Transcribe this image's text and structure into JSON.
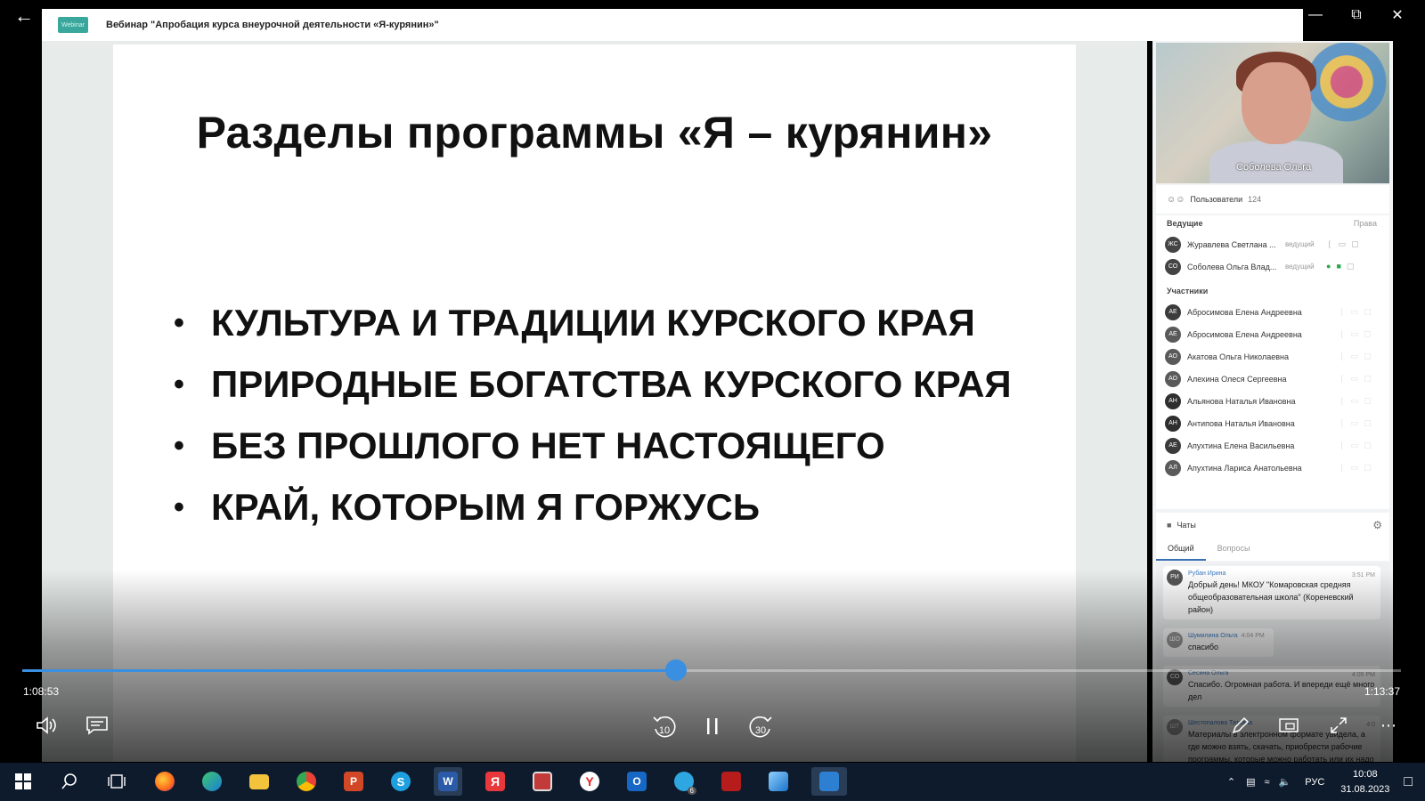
{
  "window": {
    "title": "Вебинар \"Апробация курса внеурочной деятельности «Я-курянин»\"",
    "logo_text": "Webinar"
  },
  "slide": {
    "title": "Разделы программы «Я – курянин»",
    "bullets": [
      "КУЛЬТУРА И ТРАДИЦИИ КУРСКОГО КРАЯ",
      "ПРИРОДНЫЕ БОГАТСТВА КУРСКОГО КРАЯ",
      "БЕЗ ПРОШЛОГО НЕТ НАСТОЯЩЕГО",
      "КРАЙ, КОТОРЫМ Я ГОРЖУСЬ"
    ]
  },
  "video": {
    "speaker_name": "Соболева Ольга"
  },
  "users": {
    "header": "Пользователи",
    "count": "124",
    "hosts_label": "Ведущие",
    "rights_label": "Права",
    "hosts": [
      {
        "initials": "ЖС",
        "name": "Журавлева Светлана ...",
        "role": "ведущий",
        "mic_on": false,
        "cam_on": false
      },
      {
        "initials": "СО",
        "name": "Соболева Ольга Влад...",
        "role": "ведущий",
        "mic_on": true,
        "cam_on": true
      }
    ],
    "participants_label": "Участники",
    "participants": [
      {
        "initials": "АЕ",
        "name": "Абросимова Елена Андреевна",
        "avatar_color": "#3b3b3b"
      },
      {
        "initials": "АЕ",
        "name": "Абросимова Елена Андреевна",
        "avatar_color": "#5a5a5a"
      },
      {
        "initials": "АО",
        "name": "Акатова Ольга Николаевна",
        "avatar_color": "#5a5a5a"
      },
      {
        "initials": "АО",
        "name": "Алехина Олеся Сергеевна",
        "avatar_color": "#5a5a5a"
      },
      {
        "initials": "АН",
        "name": "Альянова Наталья Ивановна",
        "avatar_color": "#2f2f2f"
      },
      {
        "initials": "АН",
        "name": "Антипова Наталья Ивановна",
        "avatar_color": "#2f2f2f"
      },
      {
        "initials": "АЕ",
        "name": "Апухтина Елена Васильевна",
        "avatar_color": "#3b3b3b"
      },
      {
        "initials": "АЛ",
        "name": "Апухтина Лариса Анатольевна",
        "avatar_color": "#5a5a5a"
      }
    ]
  },
  "chats": {
    "header": "Чаты",
    "tabs": [
      "Общий",
      "Вопросы"
    ],
    "active_tab": "Общий",
    "messages": [
      {
        "initials": "РИ",
        "author": "Рубан Ирина",
        "time": "3:51 PM",
        "text": "Добрый день! МКОУ \"Комаровская средняя общеобразовательная школа\" (Кореневский район)"
      },
      {
        "initials": "ШО",
        "author": "Шумилина Ольга",
        "time": "4:04 PM",
        "text": "спасибо"
      },
      {
        "initials": "СО",
        "author": "Сесина Ольга",
        "time": "4:05 PM",
        "text": "Спасибо. Огромная работа. И впереди ещё много дел"
      },
      {
        "initials": "ШТ",
        "author": "Шестопалова Татьяна",
        "time": "4:0",
        "text": "Материалы в электронном формате увидела, а где можно взять, скачать, приобрести рабочие программы, которые можно работать или их надо самостоятельно составить? Подскажите, пожалуйста."
      }
    ]
  },
  "player": {
    "current_time": "1:08:53",
    "total_time": "1:13:37",
    "progress": 0.474,
    "rewind_label": "10",
    "forward_label": "30",
    "accent": "#3a8fe0"
  },
  "taskbar": {
    "icons": [
      "windows-start",
      "search",
      "task-view",
      "firefox",
      "edge",
      "file-explorer",
      "chrome",
      "powerpoint",
      "skype",
      "word",
      "yandex",
      "app-viewer",
      "yandex-browser",
      "outlook",
      "telegram",
      "acrobat",
      "photos",
      "media-player"
    ],
    "telegram_badge": "6",
    "language": "РУС",
    "time": "10:08",
    "date": "31.08.2023"
  }
}
